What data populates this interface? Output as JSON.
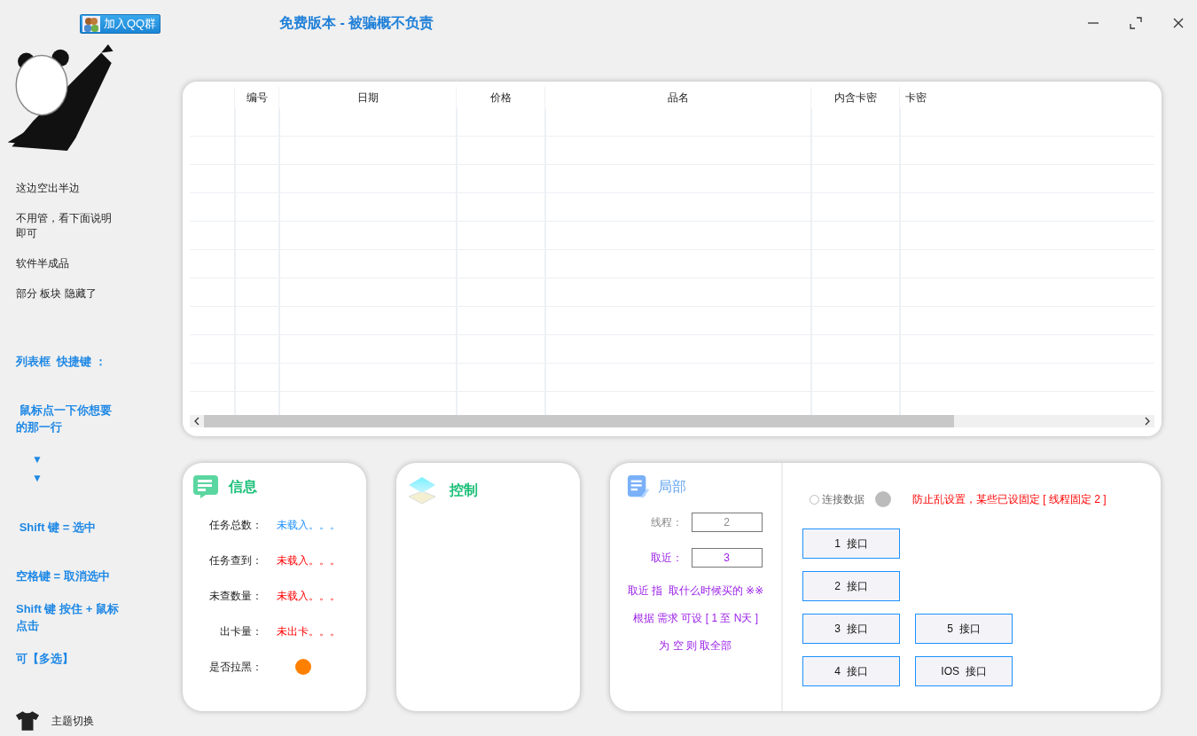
{
  "qq_button": {
    "label": "加入QQ群"
  },
  "title": "免费版本 - 被骗概不负责",
  "sidebar": {
    "notes": [
      "这边空出半边",
      "不用管，看下面说明即可",
      "软件半成品",
      "部分 板块 隐藏了"
    ],
    "help": [
      {
        "kind": "text",
        "text": "列表框  快捷键 ："
      },
      {
        "kind": "text",
        "text": " 鼠标点一下你想要的那一行"
      },
      {
        "kind": "arrow",
        "text": "▼"
      },
      {
        "kind": "arrow",
        "text": "▼"
      },
      {
        "kind": "text",
        "text": " Shift 键 = 选中"
      },
      {
        "kind": "text",
        "text": "空格键 = 取消选中"
      },
      {
        "kind": "text",
        "text": "Shift 键 按住 + 鼠标点击"
      },
      {
        "kind": "text",
        "text": "可【多选】"
      }
    ],
    "theme_button": {
      "label": "主题切换"
    }
  },
  "table": {
    "columns": [
      "编号",
      "日期",
      "价格",
      "品名",
      "内含卡密",
      "卡密"
    ]
  },
  "info_panel": {
    "title": "信息",
    "rows": [
      {
        "kind": "info",
        "label": "任务总数：",
        "value": "未载入。。。"
      },
      {
        "kind": "alert",
        "label": "任务查到：",
        "value": "未载入。。。"
      },
      {
        "kind": "alert",
        "label": "未查数量：",
        "value": "未载入。。。"
      },
      {
        "kind": "alert",
        "label": "出卡量：",
        "value": "未出卡。。。"
      }
    ],
    "blacklist": {
      "label": "是否拉黑：",
      "color": "#ff8000"
    }
  },
  "control_panel": {
    "title": "控制"
  },
  "local_panel": {
    "title": "局部",
    "fields": [
      {
        "label": "线程：",
        "value": "2",
        "disabled": true
      },
      {
        "label": "取近：",
        "value": "3",
        "disabled": false
      }
    ],
    "notes": [
      "取近 指  取什么时候买的 ※※",
      "根据 需求 可设 [ 1 至 N天 ]",
      "为 空 则 取全部"
    ]
  },
  "connection": {
    "label": "连接数据",
    "checked": false,
    "connected": false,
    "warning": "防止乱设置，某些已设固定 [ 线程固定 2 ]"
  },
  "interfaces": [
    [
      "1  接口"
    ],
    [
      "2  接口"
    ],
    [
      "3  接口",
      "5  接口"
    ],
    [
      "4  接口",
      "IOS  接口"
    ]
  ]
}
